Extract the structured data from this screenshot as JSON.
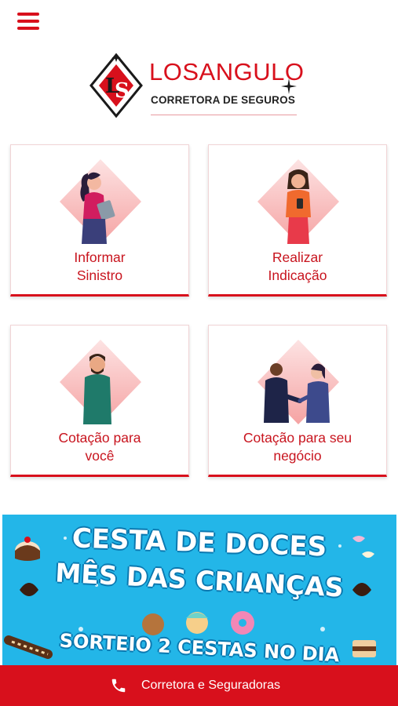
{
  "header": {
    "menu_icon": "hamburger-menu-icon",
    "brand_name": "LOSANGULO",
    "brand_subtitle": "CORRETORA DE SEGUROS",
    "brand_mark_text": "LS"
  },
  "colors": {
    "accent": "#d8101c",
    "card_text": "#c8141e",
    "banner_bg": "#23b6e8"
  },
  "cards": [
    {
      "line1": "Informar",
      "line2": "Sinistro",
      "illustration": "woman-with-clipboard"
    },
    {
      "line1": "Realizar",
      "line2": "Indicação",
      "illustration": "woman-with-phone"
    },
    {
      "line1": "Cotação para",
      "line2": "você",
      "illustration": "bearded-man"
    },
    {
      "line1": "Cotação para seu",
      "line2": "negócio",
      "illustration": "business-handshake"
    }
  ],
  "banner": {
    "title_line1": "CESTA DE DOCES",
    "title_line2": "MÊS DAS CRIANÇAS",
    "title_line3": "SORTEIO 2 CESTAS NO DIA"
  },
  "bottom_bar": {
    "icon": "phone-icon",
    "label": "Corretora e Seguradoras"
  }
}
